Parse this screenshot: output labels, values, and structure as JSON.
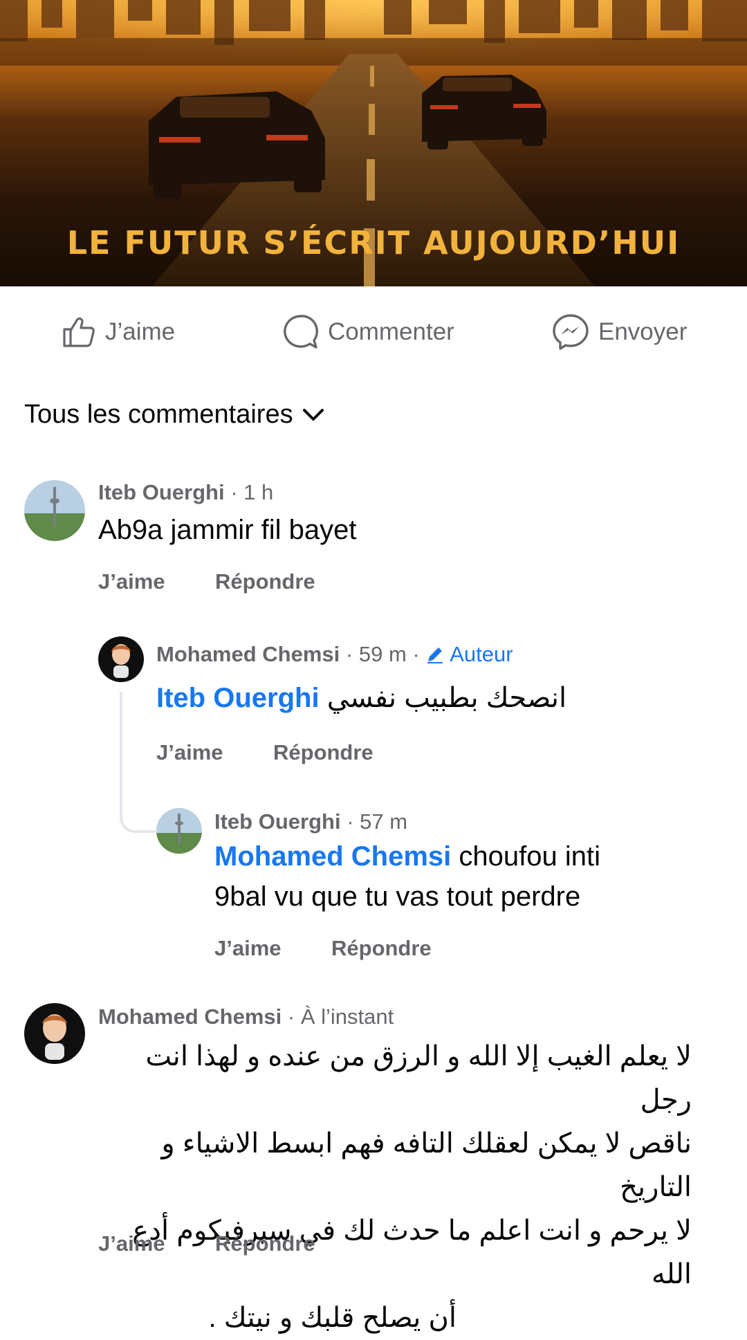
{
  "banner": {
    "title": "LE FUTUR S’ÉCRIT AUJOURD’HUI"
  },
  "actions": {
    "like": "J’aime",
    "comment": "Commenter",
    "send": "Envoyer"
  },
  "comments_header": {
    "label": "Tous les commentaires"
  },
  "comments": [
    {
      "author": "Iteb Ouerghi",
      "time": "1 h",
      "text": "Ab9a jammir fil bayet",
      "like": "J’aime",
      "reply": "Répondre",
      "replies": [
        {
          "author": "Mohamed Chemsi",
          "time": "59 m",
          "badge": "Auteur",
          "mention": "Iteb Ouerghi",
          "text": "انصحك بطبيب نفسي",
          "like": "J’aime",
          "reply": "Répondre"
        },
        {
          "author": "Iteb Ouerghi",
          "time": "57 m",
          "mention": "Mohamed Chemsi",
          "text_line1": "choufou inti",
          "text_line2": "9bal vu que tu vas tout perdre",
          "like": "J’aime",
          "reply": "Répondre"
        }
      ]
    },
    {
      "author": "Mohamed Chemsi",
      "time": "À l’instant",
      "lines": [
        "لا يعلم الغيب إلا الله و الرزق من عنده و لهذا انت رجل",
        "ناقص لا يمكن لعقلك التافه فهم ابسط الاشياء و التاريخ",
        "لا يرحم و انت اعلم ما حدث لك في سيرفيكوم أدع الله",
        "أن يصلح قلبك و نيتك ."
      ],
      "like": "J’aime",
      "reply": "Répondre"
    }
  ],
  "colors": {
    "link": "#1877f2",
    "secondary": "#65676b",
    "banner_text": "#f2b33d"
  },
  "icons": [
    "like-icon",
    "comment-icon",
    "messenger-icon",
    "chevron-down-icon",
    "pencil-icon"
  ]
}
